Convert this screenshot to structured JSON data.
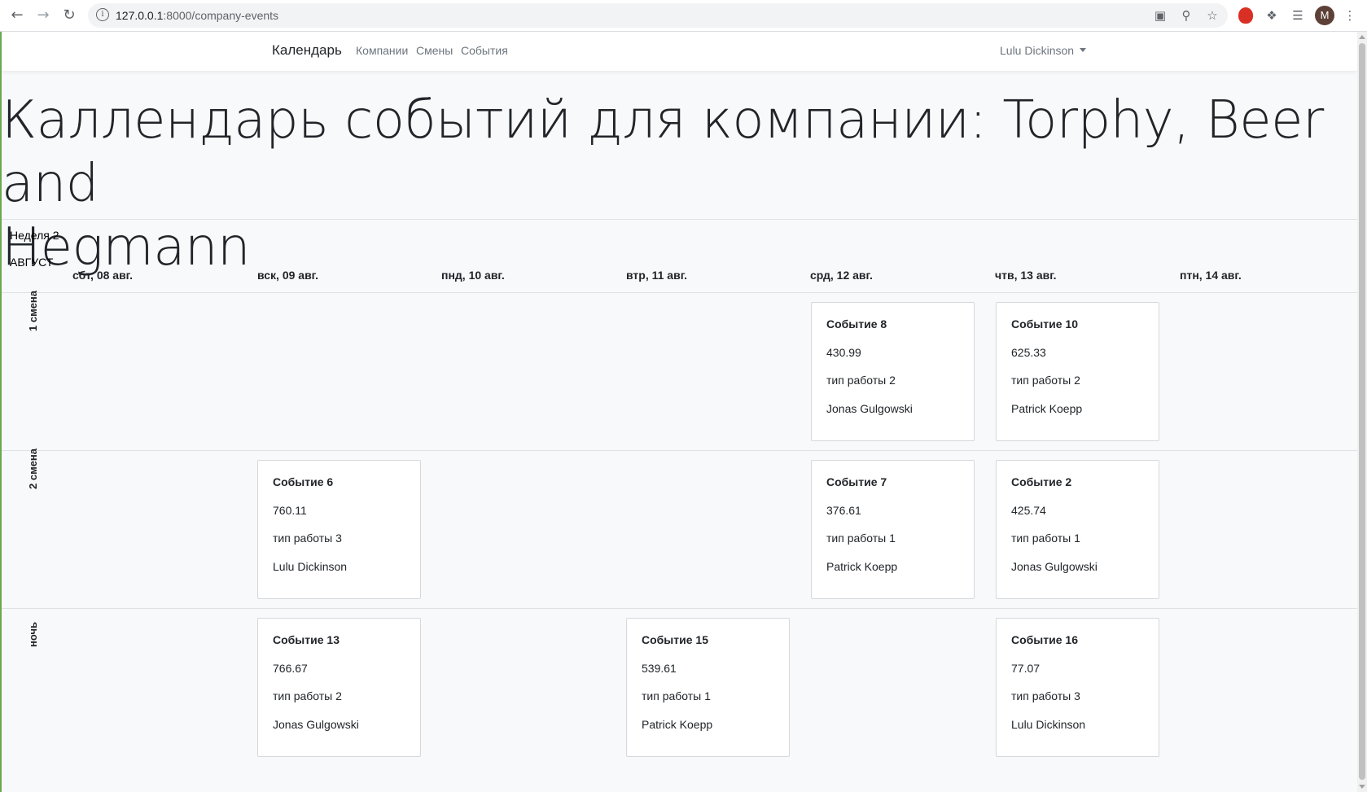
{
  "browser": {
    "url_host": "127.0.0.1",
    "url_rest": ":8000/company-events",
    "avatar_letter": "M"
  },
  "nav": {
    "brand": "Календарь",
    "links": [
      "Компании",
      "Смены",
      "События"
    ],
    "user": "Lulu Dickinson"
  },
  "page": {
    "title_line1": "Каллендарь событий для компании: Torphy, Beer and",
    "title_line2": "Hegmann",
    "week": "Неделя 2",
    "month": "АВГУСТ"
  },
  "days": [
    "сбт, 08 авг.",
    "вск, 09 авг.",
    "пнд, 10 авг.",
    "втр, 11 авг.",
    "срд, 12 авг.",
    "чтв, 13 авг.",
    "птн, 14 авг."
  ],
  "shifts": [
    "1 смена",
    "2 смена",
    "ночь"
  ],
  "events": [
    {
      "title": "Событие 8",
      "amount": "430.99",
      "work_type": "тип работы 2",
      "person": "Jonas Gulgowski"
    },
    {
      "title": "Событие 10",
      "amount": "625.33",
      "work_type": "тип работы 2",
      "person": "Patrick Koepp"
    },
    {
      "title": "Событие 6",
      "amount": "760.11",
      "work_type": "тип работы 3",
      "person": "Lulu Dickinson"
    },
    {
      "title": "Событие 7",
      "amount": "376.61",
      "work_type": "тип работы 1",
      "person": "Patrick Koepp"
    },
    {
      "title": "Событие 2",
      "amount": "425.74",
      "work_type": "тип работы 1",
      "person": "Jonas Gulgowski"
    },
    {
      "title": "Событие 13",
      "amount": "766.67",
      "work_type": "тип работы 2",
      "person": "Jonas Gulgowski"
    },
    {
      "title": "Событие 15",
      "amount": "539.61",
      "work_type": "тип работы 1",
      "person": "Patrick Koepp"
    },
    {
      "title": "Событие 16",
      "amount": "77.07",
      "work_type": "тип работы 3",
      "person": "Lulu Dickinson"
    }
  ]
}
